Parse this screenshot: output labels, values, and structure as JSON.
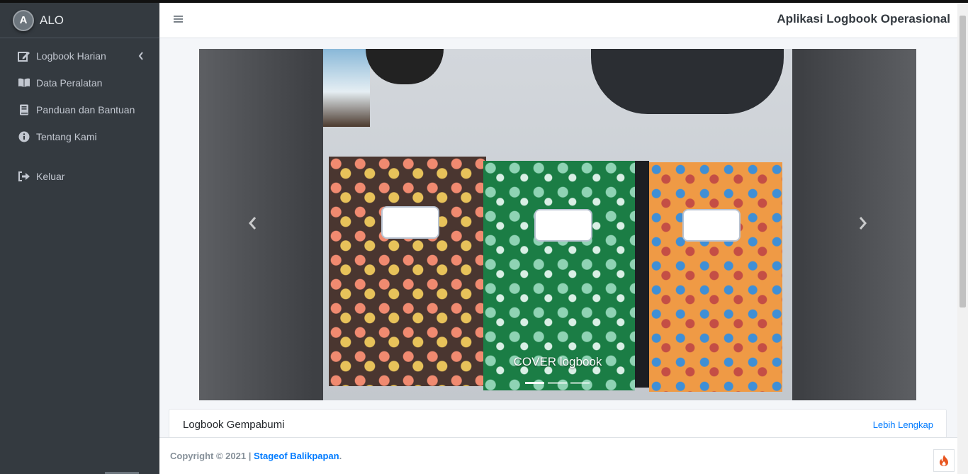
{
  "brand": {
    "name": "ALO",
    "logo_letter": "A"
  },
  "sidebar": {
    "items": [
      {
        "label": "Logbook Harian",
        "icon": "edit-icon"
      },
      {
        "label": "Data Peralatan",
        "icon": "book-open-icon"
      },
      {
        "label": "Panduan dan Bantuan",
        "icon": "book-icon"
      },
      {
        "label": "Tentang Kami",
        "icon": "info-circle-icon"
      },
      {
        "label": "Keluar",
        "icon": "sign-out-icon"
      }
    ]
  },
  "header": {
    "title": "Aplikasi Logbook Operasional"
  },
  "carousel": {
    "caption": "COVER logbook",
    "slides_count": 3,
    "active_index": 0
  },
  "card": {
    "title": "Logbook Gempabumi",
    "link": "Lebih Lengkap"
  },
  "footer": {
    "prefix": "Copyright © 2021 | ",
    "org": "Stageof Balikpapan",
    "suffix": "."
  },
  "colors": {
    "sidebar": "#343a40",
    "accent": "#007bff",
    "flame": "#e8551f"
  }
}
